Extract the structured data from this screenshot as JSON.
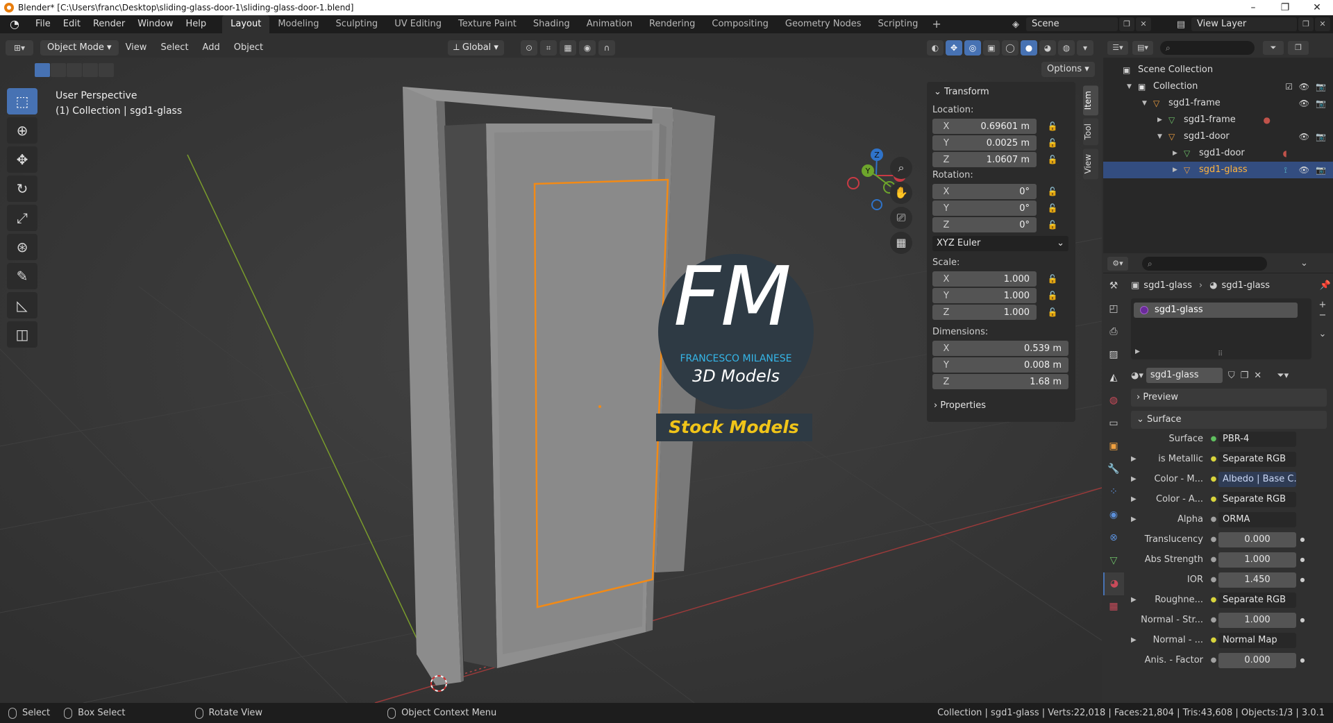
{
  "window": {
    "title": "Blender* [C:\\Users\\franc\\Desktop\\sliding-glass-door-1\\sliding-glass-door-1.blend]",
    "controls": [
      "–",
      "❐",
      "✕"
    ]
  },
  "menu": [
    "File",
    "Edit",
    "Render",
    "Window",
    "Help"
  ],
  "workspaces": [
    "Layout",
    "Modeling",
    "Sculpting",
    "UV Editing",
    "Texture Paint",
    "Shading",
    "Animation",
    "Rendering",
    "Compositing",
    "Geometry Nodes",
    "Scripting"
  ],
  "active_workspace": "Layout",
  "scene": {
    "name": "Scene",
    "view_layer": "View Layer"
  },
  "viewport": {
    "mode": "Object Mode",
    "menus": [
      "View",
      "Select",
      "Add",
      "Object"
    ],
    "orientation": "Global",
    "options_label": "Options",
    "perspective": "User Perspective",
    "collection_info": "(1) Collection | sgd1-glass",
    "gizmo_labels": {
      "x": "X",
      "y": "Y",
      "z": "Z"
    }
  },
  "watermark": {
    "logo_letters": "FM",
    "author": "FRANCESCO MILANESE",
    "subtitle": "3D Models",
    "banner": "Stock Models",
    "colors": {
      "circle": "#2e3a44",
      "letter_f": "#ffffff",
      "letter_m": "#35b6e8",
      "banner_text": "#f0c419"
    }
  },
  "npanel": {
    "tabs": [
      "Item",
      "Tool",
      "View"
    ],
    "active_tab": "Item",
    "transform_title": "Transform",
    "location_label": "Location:",
    "location": [
      {
        "axis": "X",
        "value": "0.69601 m"
      },
      {
        "axis": "Y",
        "value": "0.0025 m"
      },
      {
        "axis": "Z",
        "value": "1.0607 m"
      }
    ],
    "rotation_label": "Rotation:",
    "rotation": [
      {
        "axis": "X",
        "value": "0°"
      },
      {
        "axis": "Y",
        "value": "0°"
      },
      {
        "axis": "Z",
        "value": "0°"
      }
    ],
    "rotation_mode": "XYZ Euler",
    "scale_label": "Scale:",
    "scale": [
      {
        "axis": "X",
        "value": "1.000"
      },
      {
        "axis": "Y",
        "value": "1.000"
      },
      {
        "axis": "Z",
        "value": "1.000"
      }
    ],
    "dimensions_label": "Dimensions:",
    "dimensions": [
      {
        "axis": "X",
        "value": "0.539 m"
      },
      {
        "axis": "Y",
        "value": "0.008 m"
      },
      {
        "axis": "Z",
        "value": "1.68 m"
      }
    ],
    "properties_title": "Properties"
  },
  "outliner": {
    "rows": [
      {
        "label": "Scene Collection",
        "indent": 0
      },
      {
        "label": "Collection",
        "indent": 1
      },
      {
        "label": "sgd1-frame",
        "indent": 2
      },
      {
        "label": "sgd1-frame",
        "indent": 3
      },
      {
        "label": "sgd1-door",
        "indent": 3
      },
      {
        "label": "sgd1-door",
        "indent": 4
      },
      {
        "label": "sgd1-glass",
        "indent": 4,
        "selected": true
      }
    ]
  },
  "properties": {
    "breadcrumb_object": "sgd1-glass",
    "breadcrumb_material": "sgd1-glass",
    "material_slot": "sgd1-glass",
    "material_name": "sgd1-glass",
    "preview_label": "Preview",
    "surface_section": "Surface",
    "surface_rows": [
      {
        "label": "Surface",
        "value": "PBR-4",
        "dot": "#5fbf5f",
        "arrow": false,
        "type": "link"
      },
      {
        "label": "is Metallic",
        "value": "Separate RGB",
        "dot": "#d8d43c",
        "arrow": true,
        "type": "link"
      },
      {
        "label": "Color - M...",
        "value": "Albedo | Base C...",
        "dot": "#d8d43c",
        "arrow": true,
        "type": "hi"
      },
      {
        "label": "Color - A...",
        "value": "Separate RGB",
        "dot": "#d8d43c",
        "arrow": true,
        "type": "link"
      },
      {
        "label": "Alpha",
        "value": "ORMA",
        "dot": "#a1a1a1",
        "arrow": true,
        "type": "link"
      },
      {
        "label": "Translucency",
        "value": "0.000",
        "dot": "#a1a1a1",
        "arrow": false,
        "type": "num"
      },
      {
        "label": "Abs Strength",
        "value": "1.000",
        "dot": "#a1a1a1",
        "arrow": false,
        "type": "num"
      },
      {
        "label": "IOR",
        "value": "1.450",
        "dot": "#a1a1a1",
        "arrow": false,
        "type": "num"
      },
      {
        "label": "Roughne...",
        "value": "Separate RGB",
        "dot": "#d8d43c",
        "arrow": true,
        "type": "link"
      },
      {
        "label": "Normal - Str...",
        "value": "1.000",
        "dot": "#a1a1a1",
        "arrow": false,
        "type": "num"
      },
      {
        "label": "Normal - ...",
        "value": "Normal Map",
        "dot": "#d8d43c",
        "arrow": true,
        "type": "link"
      },
      {
        "label": "Anis. - Factor",
        "value": "0.000",
        "dot": "#a1a1a1",
        "arrow": false,
        "type": "num"
      }
    ]
  },
  "statusbar": {
    "select": "Select",
    "box_select": "Box Select",
    "rotate_view": "Rotate View",
    "context_menu": "Object Context Menu",
    "stats": "Collection | sgd1-glass | Verts:22,018 | Faces:21,804 | Tris:43,608 | Objects:1/3 | 3.0.1"
  }
}
